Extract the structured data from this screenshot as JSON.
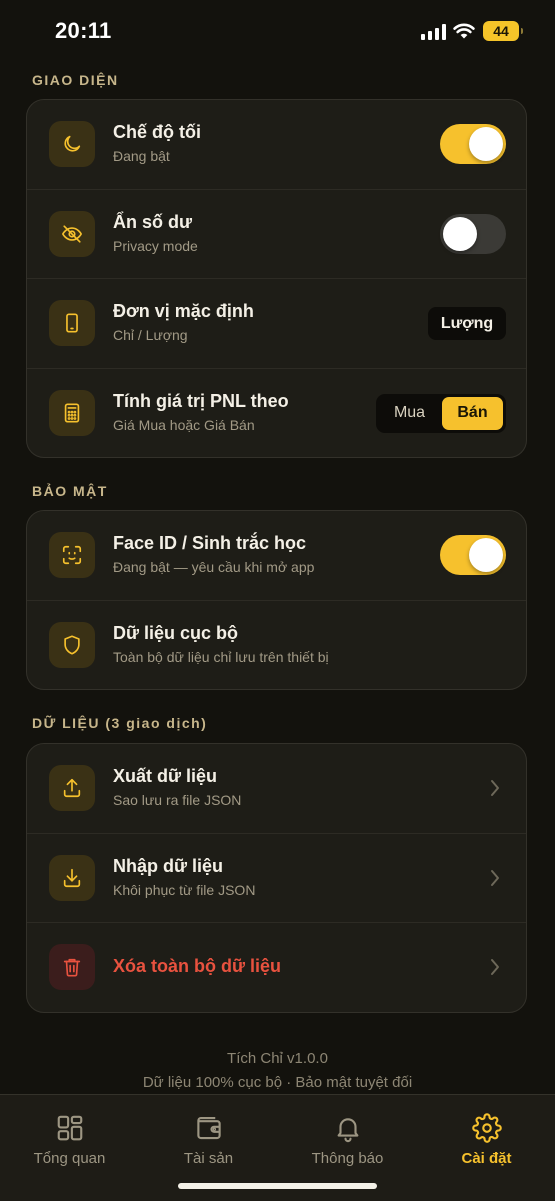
{
  "status": {
    "time": "20:11",
    "battery": "44"
  },
  "sections": {
    "interface": {
      "title": "GIAO DIỆN",
      "dark_mode": {
        "title": "Chế độ tối",
        "subtitle": "Đang bật",
        "enabled": true
      },
      "hide_balance": {
        "title": "Ẩn số dư",
        "subtitle": "Privacy mode",
        "enabled": false
      },
      "default_unit": {
        "title": "Đơn vị mặc định",
        "subtitle": "Chỉ / Lượng",
        "value": "Lượng"
      },
      "pnl": {
        "title": "Tính giá trị PNL theo",
        "subtitle": "Giá Mua hoặc Giá Bán",
        "option_buy": "Mua",
        "option_sell": "Bán",
        "selected": "Bán"
      }
    },
    "security": {
      "title": "BẢO MẬT",
      "face_id": {
        "title": "Face ID / Sinh trắc học",
        "subtitle": "Đang bật — yêu cầu khi mở app",
        "enabled": true
      },
      "local_data": {
        "title": "Dữ liệu cục bộ",
        "subtitle": "Toàn bộ dữ liệu chỉ lưu trên thiết bị"
      }
    },
    "data": {
      "title": "DỮ LIỆU (3 giao dịch)",
      "export": {
        "title": "Xuất dữ liệu",
        "subtitle": "Sao lưu ra file JSON"
      },
      "import": {
        "title": "Nhập dữ liệu",
        "subtitle": "Khôi phục từ file JSON"
      },
      "delete_all": {
        "title": "Xóa toàn bộ dữ liệu"
      }
    }
  },
  "footer": {
    "version": "Tích Chỉ v1.0.0",
    "tagline": "Dữ liệu 100% cục bộ · Bảo mật tuyệt đối"
  },
  "tabs": [
    {
      "label": "Tổng quan",
      "icon": "grid-icon"
    },
    {
      "label": "Tài sản",
      "icon": "wallet-icon"
    },
    {
      "label": "Thông báo",
      "icon": "bell-icon"
    },
    {
      "label": "Cài đặt",
      "icon": "gear-icon",
      "active": true
    }
  ],
  "colors": {
    "accent": "#f6c12d",
    "background": "#13120d",
    "card": "#1e1d17",
    "danger": "#e8523f"
  }
}
